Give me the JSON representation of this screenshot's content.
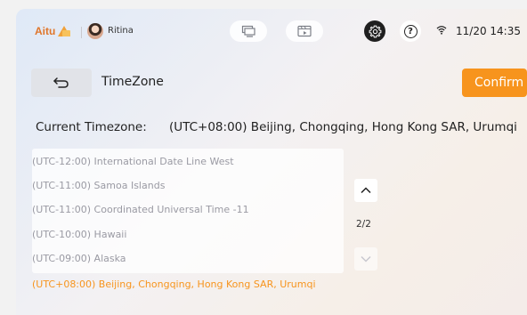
{
  "status_bar": {
    "brand": "Aitu",
    "username": "Ritina",
    "clock": "11/20 14:35",
    "icons": [
      "brand-logo-icon",
      "avatar",
      "monitor-icon",
      "media-icon",
      "gear-icon",
      "help-icon",
      "wifi-icon"
    ]
  },
  "header": {
    "title": "TimeZone",
    "confirm_label": "Confirm",
    "accent_color": "#f7941d"
  },
  "current": {
    "label": "Current Timezone:",
    "value": "(UTC+08:00) Beijing, Chongqing, Hong Kong SAR, Urumqi"
  },
  "timezones": [
    {
      "label": "(UTC-12:00) International Date Line West",
      "selected": false
    },
    {
      "label": "(UTC-11:00) Samoa Islands",
      "selected": false
    },
    {
      "label": "(UTC-11:00) Coordinated Universal Time -11",
      "selected": false
    },
    {
      "label": "(UTC-10:00) Hawaii",
      "selected": false
    },
    {
      "label": "(UTC-09:00) Alaska",
      "selected": false
    },
    {
      "label": "(UTC+08:00) Beijing, Chongqing, Hong Kong SAR, Urumqi",
      "selected": true
    }
  ],
  "pagination": {
    "indicator": "2/2"
  }
}
